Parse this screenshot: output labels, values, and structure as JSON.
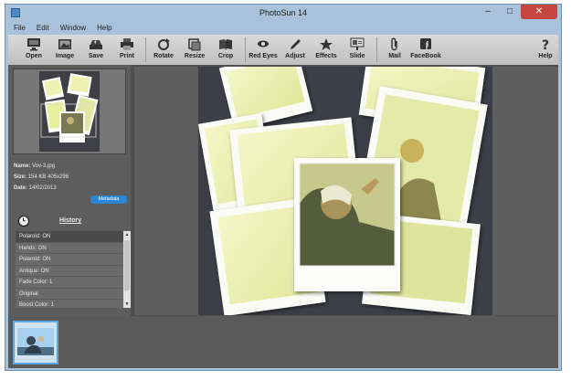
{
  "window": {
    "title": "PhotoSun 14"
  },
  "window_controls": {
    "minimize": "–",
    "maximize": "□",
    "close": "✕"
  },
  "menu": [
    "File",
    "Edit",
    "Window",
    "Help"
  ],
  "toolbar": [
    {
      "label": "Open",
      "icon": "monitor-icon"
    },
    {
      "label": "Image",
      "icon": "image-icon"
    },
    {
      "label": "Save",
      "icon": "save-tray-icon"
    },
    {
      "label": "Print",
      "icon": "printer-icon"
    },
    {
      "label": "Rotate",
      "icon": "rotate-icon"
    },
    {
      "label": "Resize",
      "icon": "resize-icon"
    },
    {
      "label": "Crop",
      "icon": "crop-book-icon"
    },
    {
      "label": "Red Eyes",
      "icon": "eye-icon"
    },
    {
      "label": "Adjust",
      "icon": "pencil-icon"
    },
    {
      "label": "Effects",
      "icon": "star-icon"
    },
    {
      "label": "Slide",
      "icon": "slideshow-icon"
    },
    {
      "label": "Mail",
      "icon": "paperclip-icon"
    },
    {
      "label": "FaceBook",
      "icon": "facebook-icon"
    },
    {
      "label": "Help",
      "icon": "question-icon"
    }
  ],
  "info": {
    "name_label": "Name:",
    "name_value": "Vov-3.jpg",
    "size_label": "Size:",
    "size_value": "154 KB  405x296",
    "date_label": "Date:",
    "date_value": "14/02/2013",
    "metadata_button": "Metadata"
  },
  "history": {
    "title": "History",
    "items": [
      "Polaroid: ON",
      "Hands: ON",
      "Polaroid: ON",
      "Antique: ON",
      "Fade Color: 1",
      "Original",
      "Boost Color: 1"
    ],
    "selected_index": 0
  },
  "colors": {
    "window_frame": "#a9c2dc",
    "toolbar": "#cfcfcf",
    "panel": "#5d5d5d",
    "accent": "#2c86d6",
    "photo_yellow": "#eef3b4"
  }
}
